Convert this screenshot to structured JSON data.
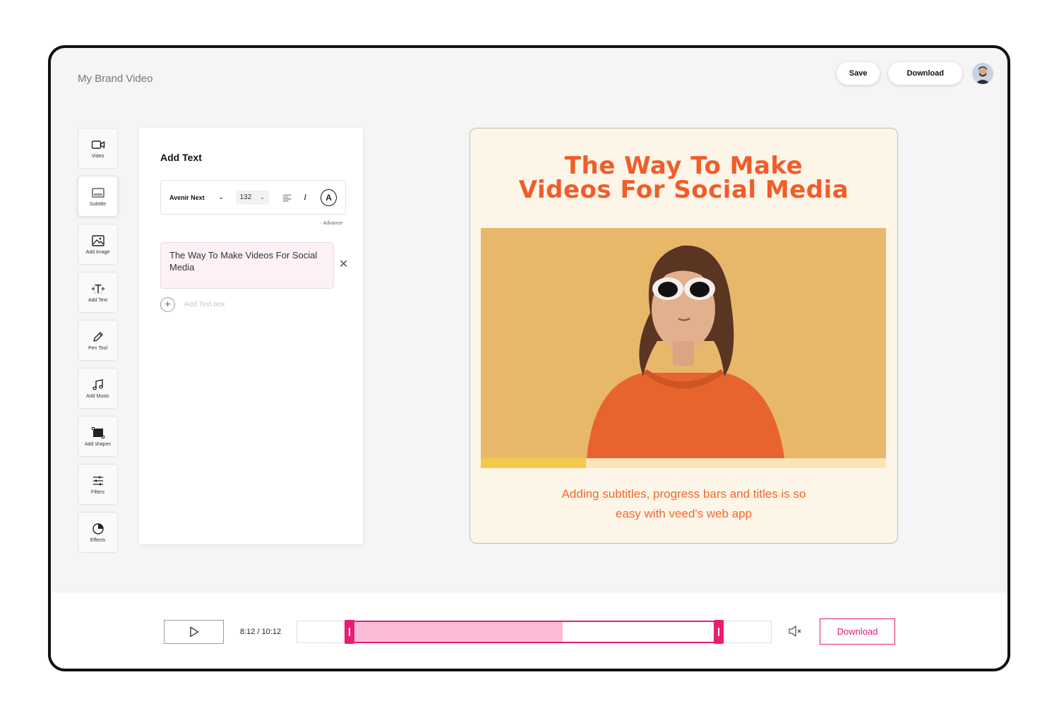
{
  "app": {
    "title": "My Brand Video"
  },
  "header": {
    "save_label": "Save",
    "download_label": "Download"
  },
  "tools": [
    {
      "label": "Video",
      "icon": "video-camera-icon"
    },
    {
      "label": "Subtitle",
      "icon": "subtitle-icon",
      "active": true
    },
    {
      "label": "Add Image",
      "icon": "image-icon"
    },
    {
      "label": "Add Text",
      "icon": "text-icon"
    },
    {
      "label": "Pen Tool",
      "icon": "pen-icon"
    },
    {
      "label": "Add Music",
      "icon": "music-note-icon"
    },
    {
      "label": "Add shapes",
      "icon": "shape-icon"
    },
    {
      "label": "Filters",
      "icon": "sliders-icon"
    },
    {
      "label": "Effects",
      "icon": "effects-icon"
    }
  ],
  "panel": {
    "title": "Add Text",
    "font": "Avenir Next",
    "size": "132",
    "color_letter": "A",
    "advance": "- Advance",
    "text_box_value": "The Way To Make Videos For Social Media",
    "add_text_box": "Add Text box"
  },
  "preview": {
    "title_line1": "The Way To Make",
    "title_line2": "Videos For Social Media",
    "subtitle_line1": "Adding subtitles, progress bars and titles is so",
    "subtitle_line2": "easy with veed's web app",
    "progress": 0.26,
    "colors": {
      "accent": "#f25c2a",
      "background": "#fdf6e8",
      "progress": "#f5c94a"
    }
  },
  "player": {
    "timecode": "8:12 / 10:12",
    "download_label": "Download",
    "selection_start": 0.1,
    "selection_end": 0.9,
    "played": 0.56,
    "accent_color": "#ea1c74"
  }
}
